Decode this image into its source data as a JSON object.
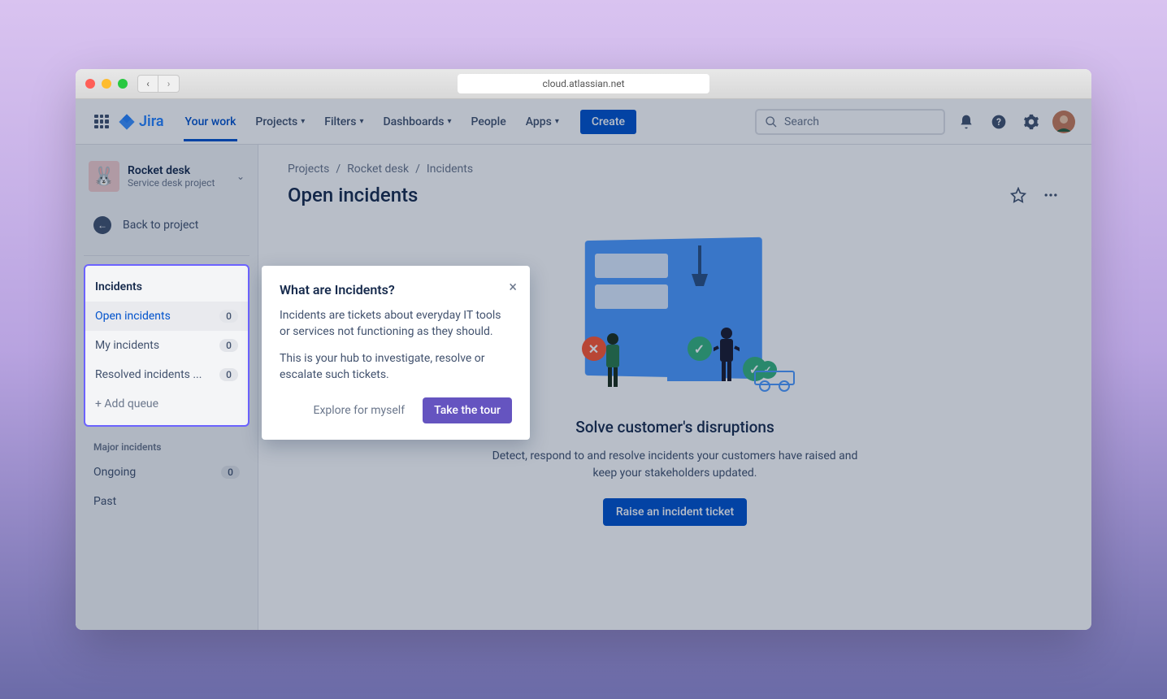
{
  "browser": {
    "url": "cloud.atlassian.net"
  },
  "app_name": "Jira",
  "topnav": {
    "items": [
      {
        "label": "Your work",
        "active": true,
        "dropdown": false
      },
      {
        "label": "Projects",
        "active": false,
        "dropdown": true
      },
      {
        "label": "Filters",
        "active": false,
        "dropdown": true
      },
      {
        "label": "Dashboards",
        "active": false,
        "dropdown": true
      },
      {
        "label": "People",
        "active": false,
        "dropdown": false
      },
      {
        "label": "Apps",
        "active": false,
        "dropdown": true
      }
    ],
    "create_label": "Create",
    "search_placeholder": "Search"
  },
  "sidebar": {
    "project_name": "Rocket desk",
    "project_type": "Service desk project",
    "back_label": "Back to project",
    "queues_section_title": "Incidents",
    "queues": [
      {
        "label": "Open incidents",
        "count": "0",
        "active": true
      },
      {
        "label": "My incidents",
        "count": "0",
        "active": false
      },
      {
        "label": "Resolved incidents ...",
        "count": "0",
        "active": false
      }
    ],
    "add_queue_label": "+ Add queue",
    "major_section_title": "Major incidents",
    "major_items": [
      {
        "label": "Ongoing",
        "count": "0"
      },
      {
        "label": "Past",
        "count": null
      }
    ]
  },
  "breadcrumb": [
    "Projects",
    "Rocket desk",
    "Incidents"
  ],
  "page_title": "Open incidents",
  "empty_state": {
    "title": "Solve customer's disruptions",
    "description": "Detect, respond to and resolve incidents your customers have raised and keep your stakeholders updated.",
    "cta_label": "Raise an incident ticket"
  },
  "popover": {
    "title": "What are Incidents?",
    "p1": "Incidents are tickets about everyday IT tools or services not functioning as they should.",
    "p2": "This is your hub to investigate, resolve or escalate such tickets.",
    "explore_label": "Explore for myself",
    "tour_label": "Take the tour"
  }
}
